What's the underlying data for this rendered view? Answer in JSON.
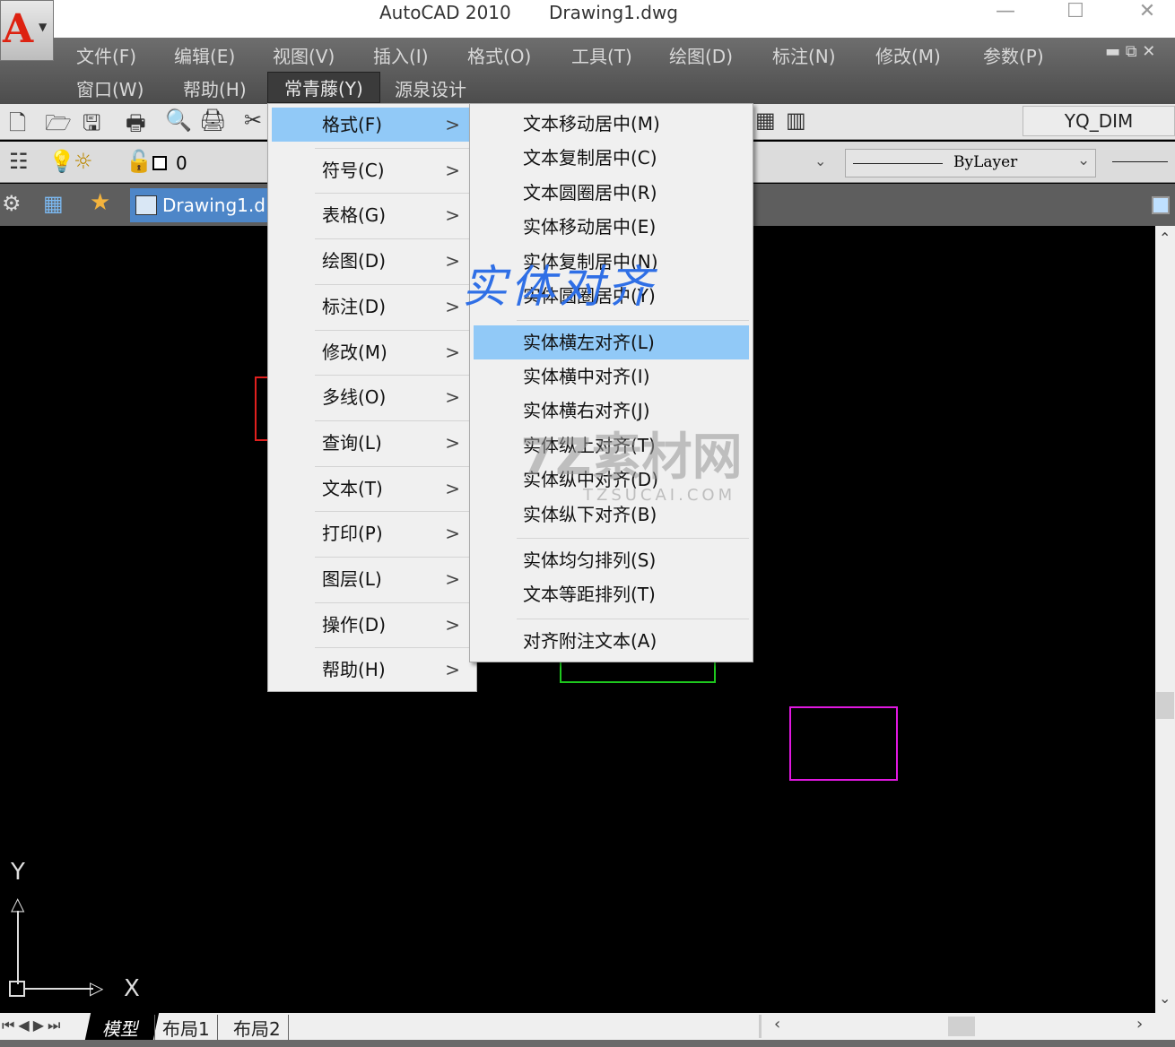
{
  "window": {
    "app": "AutoCAD 2010",
    "file": "Drawing1.dwg"
  },
  "menubar": {
    "row1": [
      "文件(F)",
      "编辑(E)",
      "视图(V)",
      "插入(I)",
      "格式(O)",
      "工具(T)",
      "绘图(D)",
      "标注(N)",
      "修改(M)",
      "参数(P)"
    ],
    "row2": [
      "窗口(W)",
      "帮助(H)",
      "常青藤(Y)",
      "源泉设计"
    ]
  },
  "toolbar": {
    "dimstyle": "YQ_DIM",
    "layer": "0",
    "linetype": "ByLayer"
  },
  "doc_tab": "Drawing1.d",
  "menu": {
    "items": [
      "格式(F)",
      "符号(C)",
      "表格(G)",
      "绘图(D)",
      "标注(D)",
      "修改(M)",
      "多线(O)",
      "查询(L)",
      "文本(T)",
      "打印(P)",
      "图层(L)",
      "操作(D)",
      "帮助(H)"
    ],
    "arrow": ">"
  },
  "submenu": {
    "items": [
      "文本移动居中(M)",
      "文本复制居中(C)",
      "文本圆圈居中(R)",
      "实体移动居中(E)",
      "实体复制居中(N)",
      "实体圆圈居中(Y)",
      "实体横左对齐(L)",
      "实体横中对齐(I)",
      "实体横右对齐(J)",
      "实体纵上对齐(T)",
      "实体纵中对齐(D)",
      "实体纵下对齐(B)",
      "实体均匀排列(S)",
      "文本等距排列(T)",
      "对齐附注文本(A)"
    ]
  },
  "annotation": "实体对齐",
  "watermark": {
    "text": "7Z素材网",
    "sub": "TZSUCAI.COM"
  },
  "ucs": {
    "y": "Y",
    "x": "X"
  },
  "layout_tabs": [
    "模型",
    "布局1",
    "布局2"
  ],
  "colors": {
    "highlight": "#91c9f7",
    "doc_tab": "#4d86c8"
  }
}
